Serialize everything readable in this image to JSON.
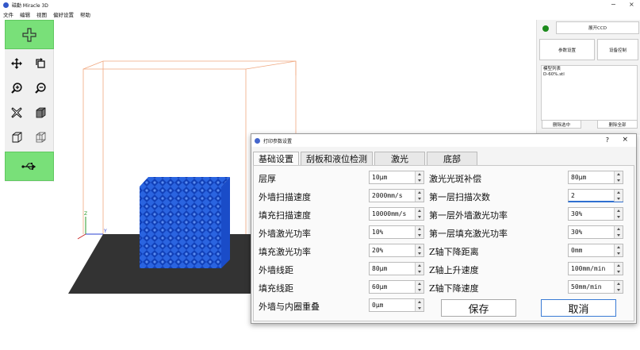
{
  "window": {
    "title": "磁勤 Miracle 3D",
    "minimize": "−",
    "close": "×"
  },
  "menu": [
    "文件",
    "编辑",
    "视图",
    "偏好设置",
    "帮助"
  ],
  "toolbar": {
    "add_icon": "plus-icon",
    "tools": [
      "move-icon",
      "rotate-icon",
      "zoom-in-icon",
      "zoom-out-icon",
      "delete-icon",
      "box-icon",
      "box-wire-icon",
      "box-outline-icon"
    ],
    "usb_icon": "usb-icon"
  },
  "right_panel": {
    "status_color": "#1c8a1c",
    "expand_label": "展开CCD",
    "param_settings_label": "参数设置",
    "device_control_label": "设备控制",
    "model_list_title": "模型列表",
    "model_items": [
      "D-60%.stl"
    ],
    "delete_selected_label": "删除选中",
    "delete_all_label": "删除全部"
  },
  "dialog": {
    "title": "打印参数设置",
    "help": "?",
    "close": "×",
    "tabs": [
      "基础设置",
      "刮板和液位检测",
      "激光",
      "底部"
    ],
    "active_tab": 0,
    "left_fields": [
      {
        "label": "层厚",
        "value": "10μm"
      },
      {
        "label": "外墙扫描速度",
        "value": "2000mm/s"
      },
      {
        "label": "填充扫描速度",
        "value": "10000mm/s"
      },
      {
        "label": "外墙激光功率",
        "value": "10%"
      },
      {
        "label": "填充激光功率",
        "value": "20%"
      },
      {
        "label": "外墙线距",
        "value": "80μm"
      },
      {
        "label": "填充线距",
        "value": "60μm"
      },
      {
        "label": "外墙与内圈重叠",
        "value": "0μm"
      }
    ],
    "right_fields": [
      {
        "label": "激光光斑补偿",
        "value": "80μm"
      },
      {
        "label": "第一层扫描次数",
        "value": "2"
      },
      {
        "label": "第一层外墙激光功率",
        "value": "30%"
      },
      {
        "label": "第一层填充激光功率",
        "value": "30%"
      },
      {
        "label": "Z轴下降距离",
        "value": "0mm"
      },
      {
        "label": "Z轴上升速度",
        "value": "100mm/min"
      },
      {
        "label": "Z轴下降速度",
        "value": "50mm/min"
      }
    ],
    "save_label": "保存",
    "cancel_label": "取消"
  },
  "scene": {
    "axis_z": "Z",
    "axis_y": "Y",
    "model_color": "#2a64e0",
    "bed_color": "#333333",
    "frame_color": "#f0a880"
  }
}
